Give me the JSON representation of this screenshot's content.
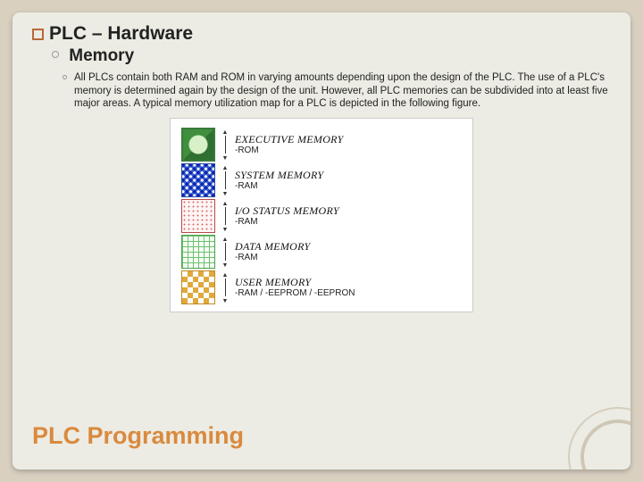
{
  "heading": {
    "main": "PLC – Hardware",
    "sub": "Memory"
  },
  "body": "All PLCs contain both RAM and ROM in varying amounts depending upon the design of the PLC. The use of a PLC's memory is determined again by the design of the unit. However, all PLC memories can be subdivided into at least five major areas. A typical memory utilization map for a PLC is depicted in the following figure.",
  "memory_map": [
    {
      "label": "EXECUTIVE MEMORY",
      "sub": "-ROM"
    },
    {
      "label": "SYSTEM MEMORY",
      "sub": "-RAM"
    },
    {
      "label": "I/O STATUS MEMORY",
      "sub": "-RAM"
    },
    {
      "label": "DATA MEMORY",
      "sub": "-RAM"
    },
    {
      "label": "USER MEMORY",
      "sub": "-RAM / -EEPROM / -EEPRON"
    }
  ],
  "footer_title": "PLC Programming"
}
